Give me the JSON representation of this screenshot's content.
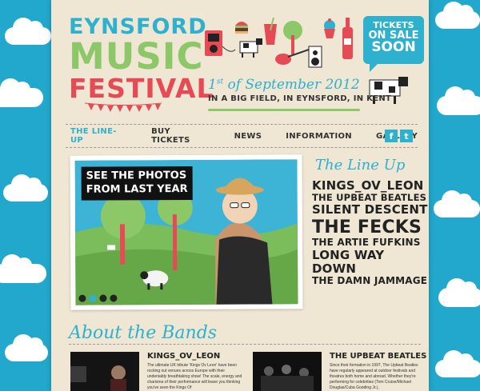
{
  "brand": {
    "line1": "EYNSFORD",
    "line2": "MUSIC",
    "line3": "FESTIVAL"
  },
  "badge": {
    "line1": "TICKETS",
    "line2": "ON SALE",
    "line3": "SOON"
  },
  "event": {
    "date_day": "1",
    "date_suffix": "st",
    "date_rest": " of September 2012",
    "location": "IN A BIG FIELD, IN EYNSFORD, IN KENT"
  },
  "nav": {
    "items": [
      {
        "label": "THE LINE-UP"
      },
      {
        "label": "BUY TICKETS"
      },
      {
        "label": "NEWS"
      },
      {
        "label": "INFORMATION"
      },
      {
        "label": "GALLERY"
      }
    ],
    "social": {
      "facebook": "f",
      "twitter": "t"
    }
  },
  "slideshow": {
    "caption_line1": "SEE THE PHOTOS",
    "caption_line2": "FROM LAST YEAR",
    "dot_count": 4,
    "active_dot": 1
  },
  "lineup": {
    "title": "The Line Up",
    "bands": [
      {
        "name": "KINGS_OV_LEON"
      },
      {
        "name": "THE UPBEAT BEATLES"
      },
      {
        "name": "SILENT DESCENT"
      },
      {
        "name": "THE FECKS"
      },
      {
        "name": "THE ARTIE FUFKINS"
      },
      {
        "name": "LONG WAY DOWN"
      },
      {
        "name": "THE DAMN JAMMAGE"
      }
    ]
  },
  "about": {
    "title": "About the Bands",
    "cards": [
      {
        "name": "KINGS_OV_LEON",
        "desc": "The ultimate UK tribute 'Kings Ov Leon' have been rocking out venues across Europe with their undeniably breathtaking show! The scale, energy and charisma of their performance will leave you thinking you've seen the Kings Of"
      },
      {
        "name": "THE UPBEAT BEATLES",
        "desc": "Since their formation in 1997, The Upbeat Beatles have regularly appeared at outdoor festivals and theatres both home and abroad. Whether they're performing for celebrities (Tom Cruise/Michael Douglas/Cuba Gooding Jr.),"
      }
    ]
  },
  "colors": {
    "sky": "#22a8cc",
    "paper": "#efe6d3",
    "accent_blue": "#2eb1cf",
    "accent_green": "#8cc768",
    "accent_red": "#e64a55"
  }
}
